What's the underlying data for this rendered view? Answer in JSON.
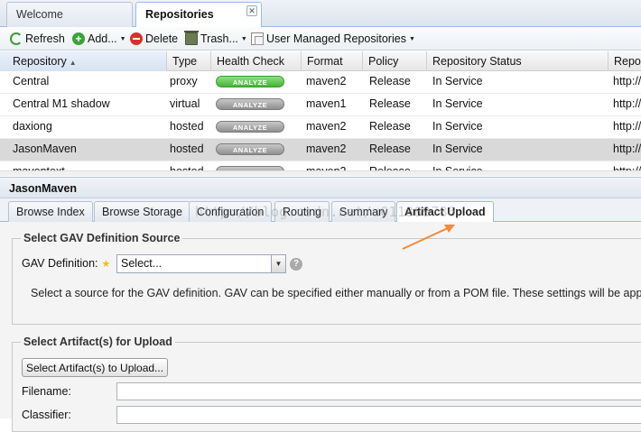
{
  "top_tabs": [
    {
      "label": "Welcome",
      "active": false
    },
    {
      "label": "Repositories",
      "active": true,
      "closable": true
    }
  ],
  "toolbar": {
    "refresh": "Refresh",
    "add": "Add...",
    "delete": "Delete",
    "trash": "Trash...",
    "user_managed": "User Managed Repositories"
  },
  "grid": {
    "columns": [
      "Repository",
      "Type",
      "Health Check",
      "Format",
      "Policy",
      "Repository Status",
      "Repos"
    ],
    "analyze_label": "ANALYZE",
    "rows": [
      {
        "name": "Central",
        "type": "proxy",
        "health": "green",
        "format": "maven2",
        "policy": "Release",
        "status": "In Service",
        "url": "http://l"
      },
      {
        "name": "Central M1 shadow",
        "type": "virtual",
        "health": "grey",
        "format": "maven1",
        "policy": "Release",
        "status": "In Service",
        "url": "http://l"
      },
      {
        "name": "daxiong",
        "type": "hosted",
        "health": "grey",
        "format": "maven2",
        "policy": "Release",
        "status": "In Service",
        "url": "http://l"
      },
      {
        "name": "JasonMaven",
        "type": "hosted",
        "health": "grey",
        "format": "maven2",
        "policy": "Release",
        "status": "In Service",
        "url": "http://l",
        "selected": true
      },
      {
        "name": "maventext",
        "type": "hosted",
        "health": "grey",
        "format": "maven2",
        "policy": "Release",
        "status": "In Service",
        "url": "http://l"
      }
    ]
  },
  "detail": {
    "title": "JasonMaven",
    "tabs": [
      "Browse Index",
      "Browse Storage",
      "Configuration",
      "Routing",
      "Summary",
      "Artifact Upload"
    ],
    "active_tab": "Artifact Upload"
  },
  "gav_section": {
    "legend": "Select GAV Definition Source",
    "label": "GAV Definition:",
    "select_value": "Select...",
    "help": "?",
    "info": "Select a source for the GAV definition. GAV can be specified either manually or from a POM file. These settings will be applied"
  },
  "artifact_section": {
    "legend": "Select Artifact(s) for Upload",
    "button": "Select Artifact(s) to Upload...",
    "filename_label": "Filename:",
    "classifier_label": "Classifier:"
  },
  "watermark": "http://blog.csdn.net/u011889786",
  "colors": {
    "accent_border": "#99bbe8",
    "annotation_arrow": "#f08a3c",
    "analyze_green": "#46b33a"
  }
}
